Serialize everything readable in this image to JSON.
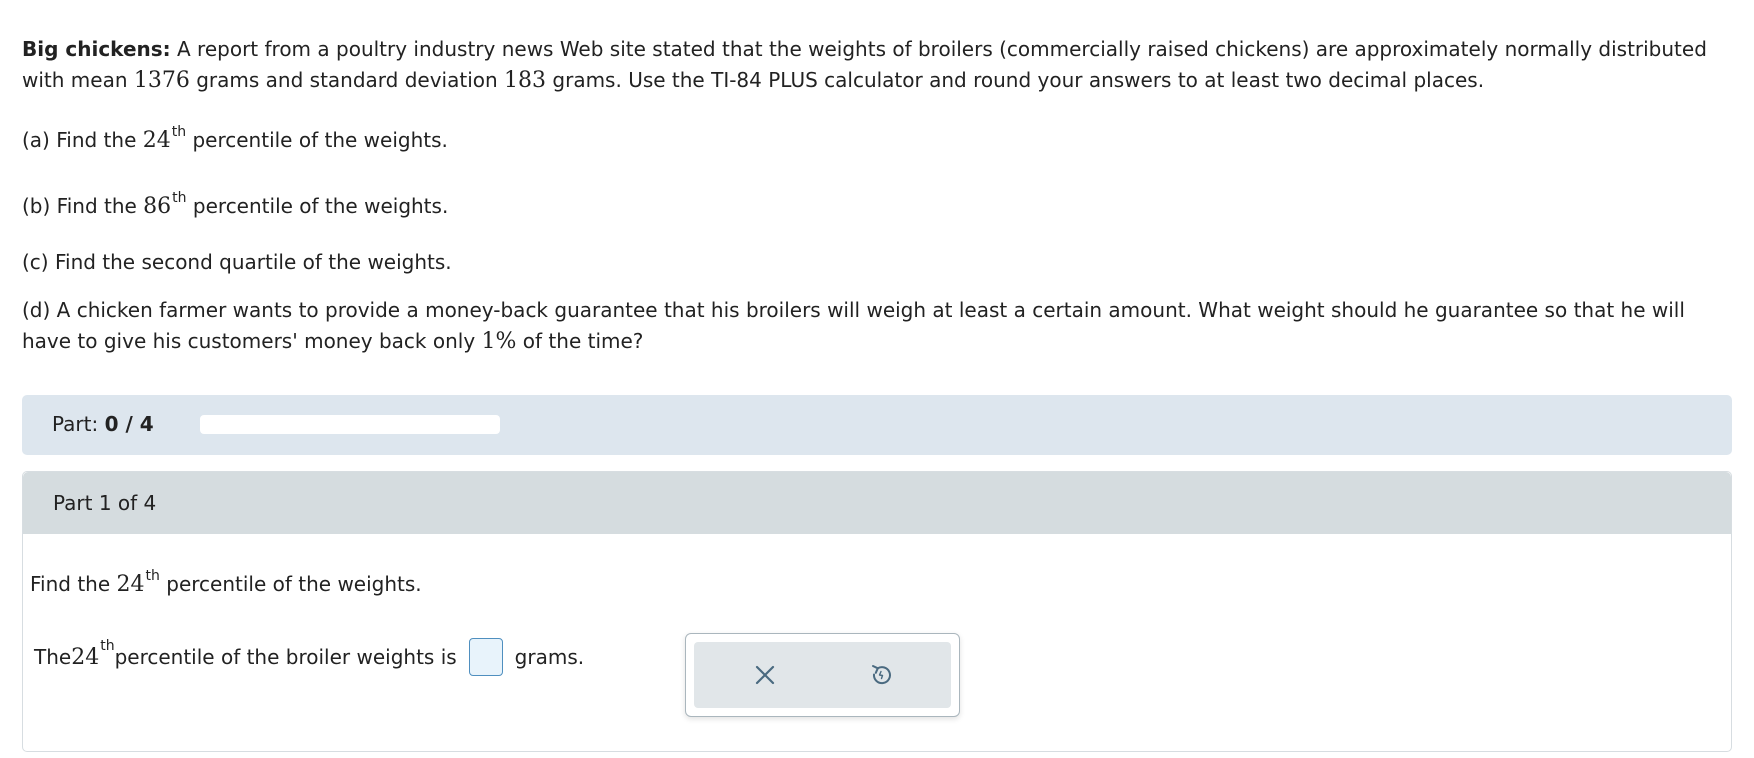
{
  "problem": {
    "title": "Big chickens:",
    "intro_1": " A report from a poultry industry news Web site stated that the weights of broilers (commercially raised chickens) are approximately normally distributed with mean ",
    "mean": "1376",
    "intro_2": " grams and standard deviation ",
    "sd": "183",
    "intro_3": " grams. Use the TI-84 PLUS calculator and round your answers to at least two decimal places."
  },
  "parts": {
    "a_pre": "(a) Find the ",
    "a_num": "24",
    "a_sup": "th",
    "a_post": " percentile of the weights.",
    "b_pre": "(b) Find the ",
    "b_num": "86",
    "b_sup": "th",
    "b_post": " percentile of the weights.",
    "c_text": "(c) Find the second quartile of the weights.",
    "d_pre": "(d) A chicken farmer wants to provide a money-back guarantee that his broilers will weigh at least a certain amount. What weight should he guarantee so that he will have to give his customers' money back only ",
    "d_num": "1%",
    "d_post": " of the time?"
  },
  "progress": {
    "label": "Part: ",
    "value_text": "0 / 4",
    "fraction": 0
  },
  "current_part": {
    "header": "Part 1 of 4",
    "question_pre": "Find the ",
    "question_num": "24",
    "question_sup": "th",
    "question_post": " percentile of the weights.",
    "answer_pre": "The ",
    "answer_num": "24",
    "answer_sup": "th",
    "answer_mid": " percentile of the broiler weights is",
    "answer_value": "",
    "answer_unit": "grams."
  },
  "actions": {
    "clear_icon": "close-icon",
    "undo_icon": "undo-icon"
  },
  "colors": {
    "progress_bg": "#dde6ee",
    "part_header_bg": "#d5dcdf",
    "input_border": "#4f8fbf",
    "icon_color": "#4a6a80"
  }
}
